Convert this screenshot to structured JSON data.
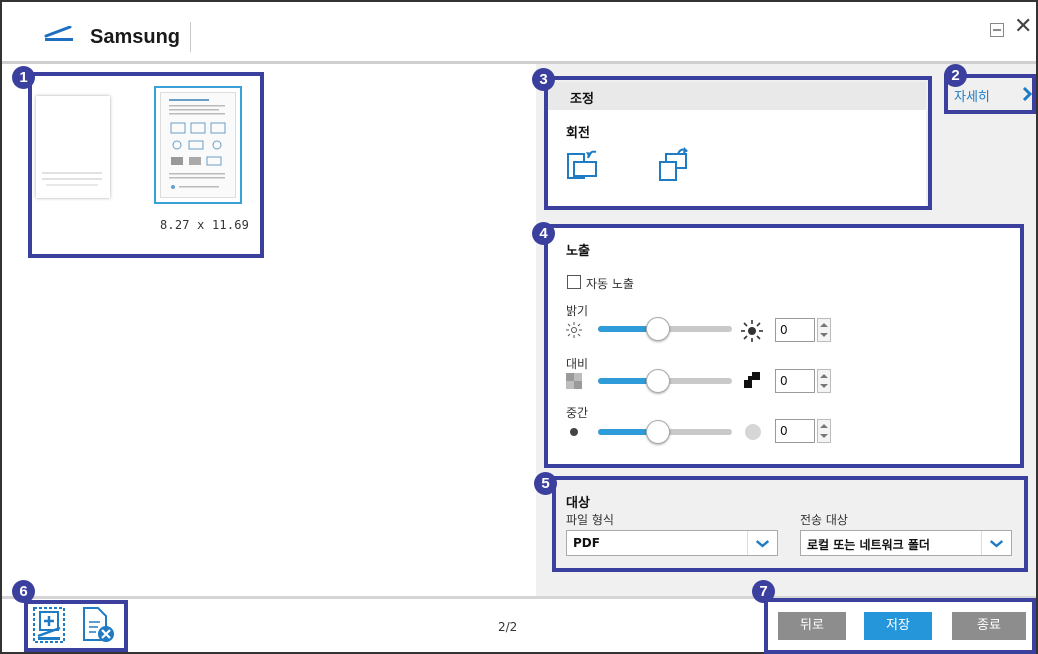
{
  "app": {
    "title": "Samsung"
  },
  "window": {
    "minimize_icon": "minimize-icon",
    "close_glyph": "✕"
  },
  "thumbnails": {
    "dimensions": "8.27  x  11.69"
  },
  "details_link": "자세히",
  "adjust": {
    "title": "조정",
    "rotate_label": "회전"
  },
  "exposure": {
    "title": "노출",
    "auto_exposure_label": "자동 노출",
    "auto_exposure_checked": false,
    "brightness": {
      "label": "밝기",
      "value": "0",
      "level": 0.45
    },
    "contrast": {
      "label": "대비",
      "value": "0",
      "level": 0.45
    },
    "midtone": {
      "label": "중간",
      "value": "0",
      "level": 0.45
    }
  },
  "destination": {
    "title": "대상",
    "file_format_label": "파일 형식",
    "file_format_value": "PDF",
    "send_to_label": "전송 대상",
    "send_to_value": "로컬 또는 네트워크 폴더"
  },
  "footer": {
    "page_count": "2/2",
    "back_label": "뒤로",
    "save_label": "저장",
    "exit_label": "종료"
  },
  "annotations": [
    "1",
    "2",
    "3",
    "4",
    "5",
    "6",
    "7"
  ],
  "colors": {
    "accent": "#2f9bd8",
    "annotation": "#3b3f9e",
    "button_gray": "#8d8d8d",
    "button_blue": "#2596d9"
  }
}
